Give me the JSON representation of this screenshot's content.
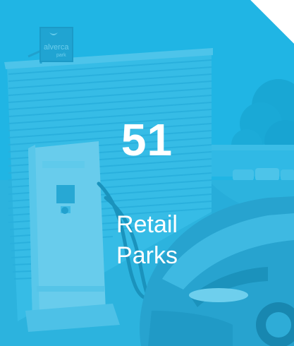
{
  "stat": {
    "number": "51",
    "label_line1": "Retail",
    "label_line2": "Parks"
  },
  "sign": {
    "text_line1": "alverca",
    "text_line2": "park"
  },
  "colors": {
    "overlay": "#1eb6e6",
    "text": "#ffffff"
  }
}
